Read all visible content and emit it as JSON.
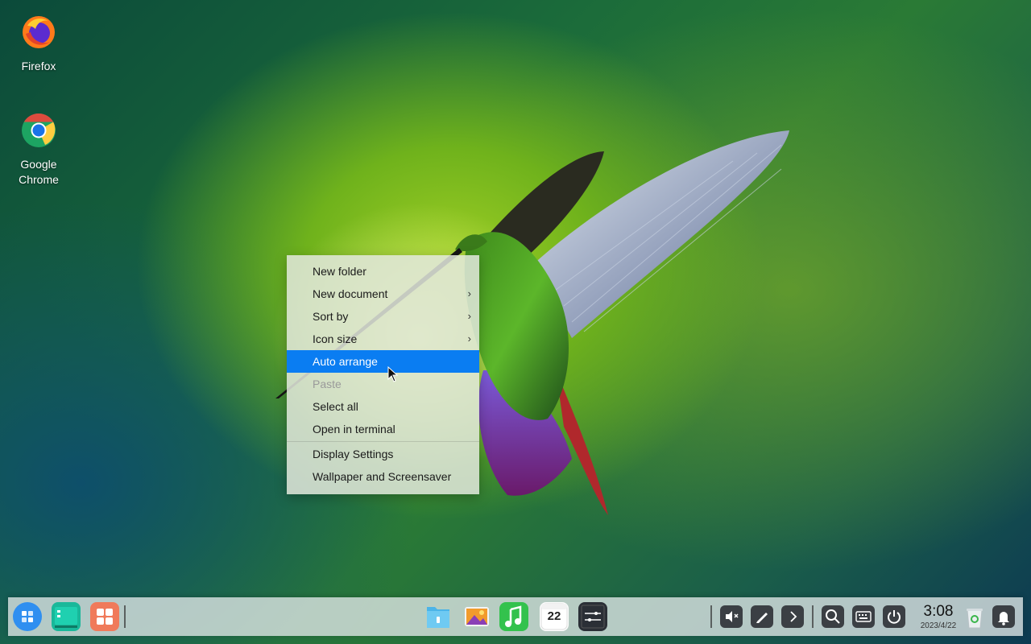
{
  "desktop": {
    "icons": [
      {
        "label": "Firefox",
        "icon": "firefox-icon"
      },
      {
        "label": "Google Chrome",
        "icon": "chrome-icon"
      }
    ],
    "wallpaper": "hummingbird-on-green"
  },
  "context_menu": {
    "items": [
      {
        "label": "New folder",
        "submenu": false
      },
      {
        "label": "New document",
        "submenu": true
      },
      {
        "label": "Sort by",
        "submenu": true
      },
      {
        "label": "Icon size",
        "submenu": true
      },
      {
        "label": "Auto arrange",
        "submenu": false,
        "highlighted": true
      },
      {
        "label": "Paste",
        "submenu": false,
        "disabled": true
      },
      {
        "label": "Select all",
        "submenu": false
      },
      {
        "label": "Open in terminal",
        "submenu": false
      },
      {
        "label": "Display Settings",
        "submenu": false
      },
      {
        "label": "Wallpaper and Screensaver",
        "submenu": false
      }
    ],
    "submenu_glyph": "›",
    "highlight_color": "#0a7df2"
  },
  "taskbar": {
    "left_apps": [
      "launcher-icon",
      "multitasking-icon",
      "app-store-icon"
    ],
    "center_apps": [
      "file-manager-icon",
      "image-viewer-icon",
      "music-icon",
      "calendar-icon",
      "terminal-icon"
    ],
    "calendar_day": "22",
    "tray": [
      "volume-muted-icon",
      "stylus-icon",
      "chevron-right-icon",
      "search-icon",
      "keyboard-icon",
      "power-icon"
    ],
    "clock": {
      "time": "3:08",
      "date": "2023/4/22"
    },
    "right": [
      "trash-icon",
      "notification-bell-icon"
    ]
  }
}
